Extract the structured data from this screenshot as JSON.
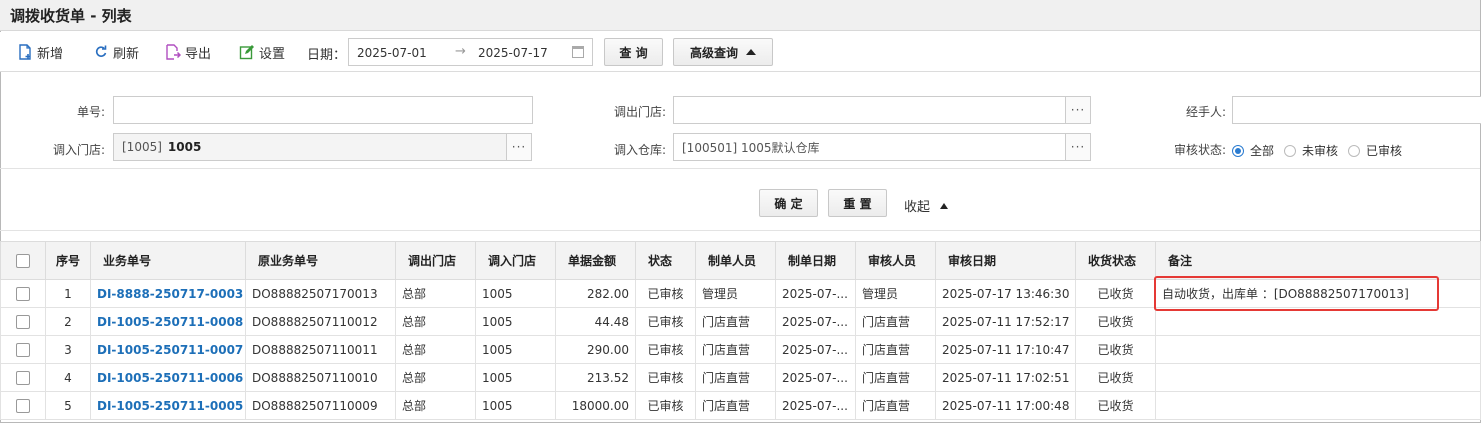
{
  "title": "调拨收货单 - 列表",
  "toolbar": {
    "add": "新增",
    "refresh": "刷新",
    "export": "导出",
    "settings": "设置",
    "date_label": "日期：",
    "date_from": "2025-07-01",
    "date_arrow": "→",
    "date_to": "2025-07-17",
    "query": "查 询",
    "advanced": "高级查询"
  },
  "filters": {
    "order_no_label": "单号:",
    "out_store_label": "调出门店:",
    "handler_label": "经手人:",
    "in_store_label": "调入门店:",
    "in_store_code": "[1005]",
    "in_store_name": "1005",
    "in_warehouse_label": "调入仓库:",
    "in_warehouse_value": "[100501] 1005默认仓库",
    "audit_label": "审核状态:",
    "audit_options": [
      "全部",
      "未审核",
      "已审核"
    ],
    "dots": "···",
    "confirm": "确 定",
    "reset": "重 置",
    "collapse": "收起"
  },
  "table": {
    "headers": [
      "序号",
      "业务单号",
      "原业务单号",
      "调出门店",
      "调入门店",
      "单据金额",
      "状态",
      "制单人员",
      "制单日期",
      "审核人员",
      "审核日期",
      "收货状态",
      "备注"
    ],
    "rows": [
      [
        "1",
        "DI-8888-250717-0003",
        "DO88882507170013",
        "总部",
        "1005",
        "282.00",
        "已审核",
        "管理员",
        "2025-07-...",
        "管理员",
        "2025-07-17 13:46:30",
        "已收货",
        "自动收货，出库单 ：[DO88882507170013]"
      ],
      [
        "2",
        "DI-1005-250711-0008",
        "DO88882507110012",
        "总部",
        "1005",
        "44.48",
        "已审核",
        "门店直营",
        "2025-07-...",
        "门店直营",
        "2025-07-11 17:52:17",
        "已收货",
        ""
      ],
      [
        "3",
        "DI-1005-250711-0007",
        "DO88882507110011",
        "总部",
        "1005",
        "290.00",
        "已审核",
        "门店直营",
        "2025-07-...",
        "门店直营",
        "2025-07-11 17:10:47",
        "已收货",
        ""
      ],
      [
        "4",
        "DI-1005-250711-0006",
        "DO88882507110010",
        "总部",
        "1005",
        "213.52",
        "已审核",
        "门店直营",
        "2025-07-...",
        "门店直营",
        "2025-07-11 17:02:51",
        "已收货",
        ""
      ],
      [
        "5",
        "DI-1005-250711-0005",
        "DO88882507110009",
        "总部",
        "1005",
        "18000.00",
        "已审核",
        "门店直营",
        "2025-07-...",
        "门店直营",
        "2025-07-11 17:00:48",
        "已收货",
        ""
      ]
    ]
  },
  "colors": {
    "link": "#1d6fb8",
    "highlight": "#e53935",
    "radio": "#2a7bd0"
  }
}
